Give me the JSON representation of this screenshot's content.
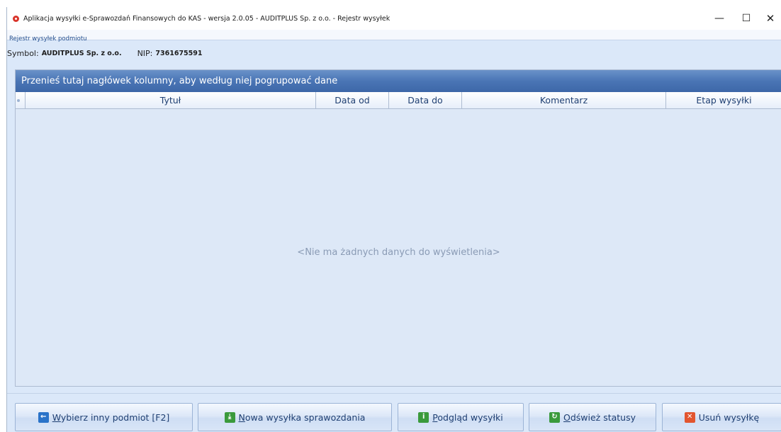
{
  "window": {
    "title": "Aplikacja wysyłki e-Sprawozdań Finansowych do KAS - wersja 2.0.05 - AUDITPLUS Sp. z o.o.  - Rejestr wysyłek",
    "controls": {
      "minimize": "—",
      "maximize": "☐",
      "close": "✕"
    }
  },
  "menu": {
    "items": [
      "Rejestr wysyłek podmiotu"
    ]
  },
  "entity": {
    "symbol_label": "Symbol:",
    "symbol_value": "AUDITPLUS Sp. z o.o.",
    "nip_label": "NIP:",
    "nip_value": "7361675591"
  },
  "grid": {
    "group_panel_text": "Przenieś tutaj nagłówek kolumny, aby według niej pogrupować dane",
    "columns": [
      "Tytuł",
      "Data od",
      "Data do",
      "Komentarz",
      "Etap wysyłki"
    ],
    "empty_text": "<Nie ma żadnych danych do wyświetlenia>"
  },
  "toolbar": {
    "buttons": [
      {
        "accel": "W",
        "rest": "ybierz inny podmiot [F2]",
        "icon": "arrow-left-icon"
      },
      {
        "accel": "N",
        "rest": "owa wysyłka sprawozdania",
        "icon": "download-icon"
      },
      {
        "accel": "P",
        "rest": "odgląd wysyłki",
        "icon": "info-icon"
      },
      {
        "accel": "O",
        "rest": "dśwież statusy",
        "icon": "refresh-icon"
      },
      {
        "accel": "",
        "rest": "Usuń wysyłkę",
        "icon": "delete-icon"
      }
    ]
  },
  "colors": {
    "group_bar": "#4a75b5",
    "background": "#dbe8f9",
    "button_text": "#1f3f72"
  }
}
